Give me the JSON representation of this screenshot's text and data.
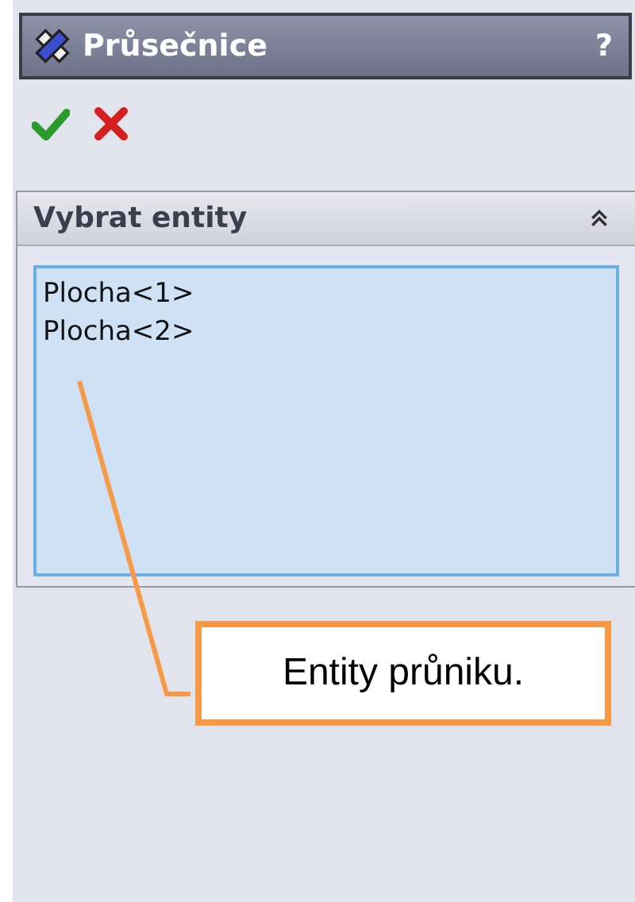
{
  "panel": {
    "title": "Průsečnice",
    "help": "?"
  },
  "actions": [
    {
      "kind": "ok"
    },
    {
      "kind": "cancel"
    }
  ],
  "group": {
    "title": "Vybrat entity",
    "expanded": true,
    "items": [
      "Plocha<1>",
      "Plocha<2>"
    ]
  },
  "callout": {
    "text": "Entity průniku."
  }
}
